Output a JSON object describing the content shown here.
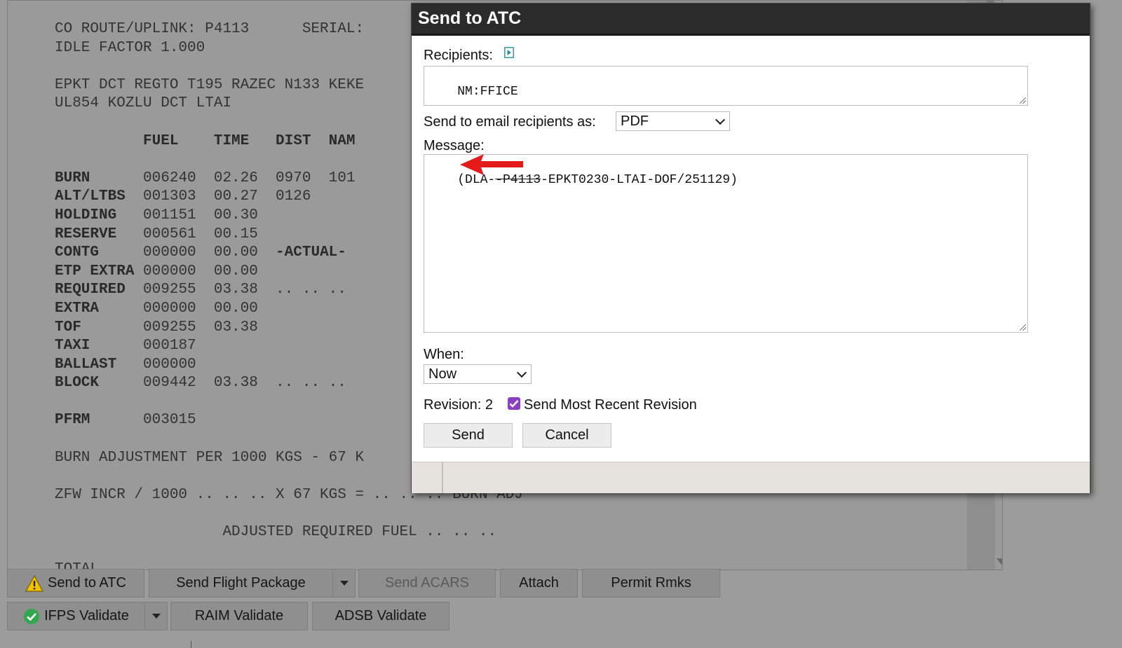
{
  "document": {
    "lines": [
      {
        "text": "CO ROUTE/UPLINK: P4113      SERIAL:",
        "bold": false
      },
      {
        "text": "IDLE FACTOR 1.000",
        "bold": false
      },
      {
        "text": "",
        "bold": false
      },
      {
        "text": "EPKT DCT REGTO T195 RAZEC N133 KEKE",
        "bold": false
      },
      {
        "text": "UL854 KOZLU DCT LTAI",
        "bold": false
      },
      {
        "text": "",
        "bold": false
      },
      {
        "label": "",
        "rest": "          FUEL    TIME   DIST  NAM",
        "boldAll": true
      },
      {
        "text": "",
        "bold": false
      },
      {
        "label": "BURN      ",
        "rest": "006240  02.26  0970  101"
      },
      {
        "label": "ALT/LTBS  ",
        "rest": "001303  00.27  0126"
      },
      {
        "label": "HOLDING   ",
        "rest": "001151  00.30"
      },
      {
        "label": "RESERVE   ",
        "rest": "000561  00.15"
      },
      {
        "label": "CONTG     ",
        "rest": "000000  00.00  ",
        "tail": "-ACTUAL-"
      },
      {
        "label": "ETP EXTRA ",
        "rest": "000000  00.00"
      },
      {
        "label": "REQUIRED  ",
        "rest": "009255  03.38  .. .. .."
      },
      {
        "label": "EXTRA     ",
        "rest": "000000  00.00"
      },
      {
        "label": "TOF       ",
        "rest": "009255  03.38"
      },
      {
        "label": "TAXI      ",
        "rest": "000187"
      },
      {
        "label": "BALLAST   ",
        "rest": "000000"
      },
      {
        "label": "BLOCK     ",
        "rest": "009442  03.38  .. .. .."
      },
      {
        "text": "",
        "bold": false
      },
      {
        "label": "PFRM      ",
        "rest": "003015"
      },
      {
        "text": "",
        "bold": false
      },
      {
        "text": "BURN ADJUSTMENT PER 1000 KGS - 67 K",
        "bold": false
      },
      {
        "text": "",
        "bold": false
      },
      {
        "text": "ZFW INCR / 1000 .. .. .. X 67 KGS = .. .. .. BURN ADJ",
        "bold": false
      },
      {
        "text": "",
        "bold": false
      },
      {
        "text": "                   ADJUSTED REQUIRED FUEL .. .. ..",
        "bold": false
      },
      {
        "text": "",
        "bold": false
      },
      {
        "text": "TOTAL",
        "bold": false
      }
    ]
  },
  "toolbar": {
    "row1": {
      "send_to_atc": "Send to ATC",
      "send_flight_package": "Send Flight Package",
      "send_acars": "Send ACARS",
      "attach": "Attach",
      "permit_rmks": "Permit Rmks"
    },
    "row2": {
      "ifps_validate": "IFPS Validate",
      "raim_validate": "RAIM Validate",
      "adsb_validate": "ADSB Validate"
    }
  },
  "modal": {
    "title": "Send to ATC",
    "recipients_label": "Recipients:",
    "recipients_value": "NM:FFICE",
    "email_as_label": "Send to email recipients as:",
    "email_as_value": "PDF",
    "message_label": "Message:",
    "message_prefix": "(DLA-",
    "message_strike": "-P4113",
    "message_suffix": "-EPKT0230-LTAI-DOF/251129)",
    "when_label": "When:",
    "when_value": "Now",
    "revision_label": "Revision: 2",
    "send_most_recent_label": "Send Most Recent Revision",
    "send_most_recent_checked": true,
    "send_button": "Send",
    "cancel_button": "Cancel"
  },
  "colors": {
    "modal_title_bg": "#2b2b2b",
    "checkbox": "#8d3fc4",
    "annotation_arrow": "#e31b1b",
    "warning_icon": "#f2c200",
    "check_icon": "#2fa84f"
  }
}
